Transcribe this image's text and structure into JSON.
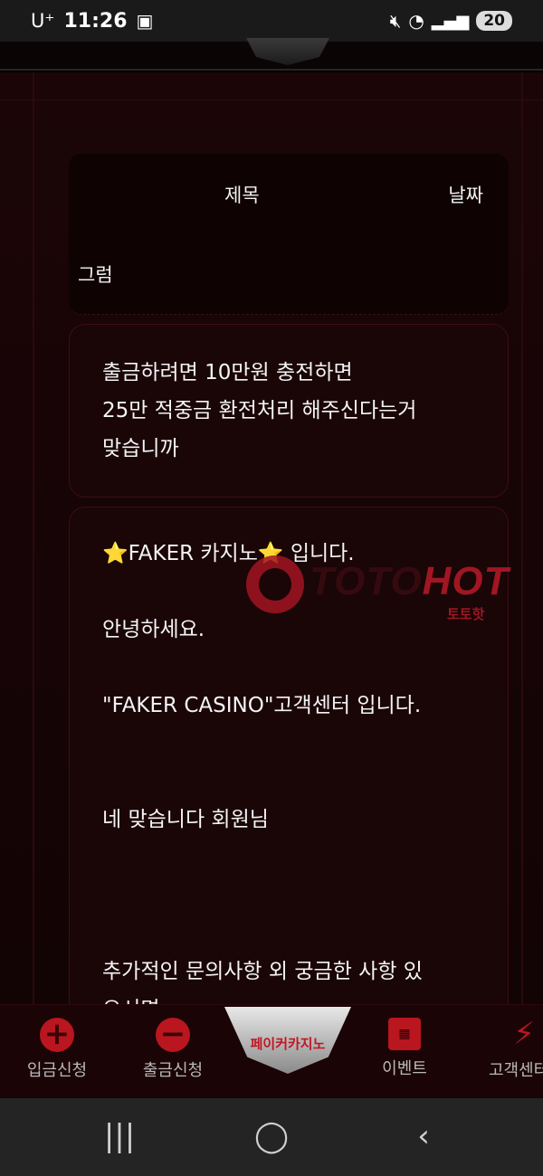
{
  "status_bar": {
    "carrier": "U⁺",
    "time": "11:26",
    "battery": "20"
  },
  "table": {
    "col_title": "제목",
    "col_date": "날짜",
    "row_title": "그럼"
  },
  "question": {
    "lines": [
      "출금하려면 10만원 충전하면",
      "25만 적중금 환전처리 해주신다는거",
      "맞습니까"
    ]
  },
  "answer": {
    "line1": "⭐FAKER 카지노⭐ 입니다.",
    "line2": "안녕하세요.",
    "line3": "\"FAKER CASINO\"고객센터 입니다.",
    "line4": "네 맞습니다 회원님",
    "line5": "추가적인 문의사항 외 궁금한 사항 있",
    "line6": "으시면"
  },
  "watermark": {
    "brand_a": "TOTO",
    "brand_b": "HOT",
    "sub": "토토핫"
  },
  "bottom_nav": {
    "deposit": "입금신청",
    "withdraw": "출금신청",
    "logo_text": "페이커카지노",
    "event": "이벤트",
    "support": "고객센터"
  },
  "colors": {
    "accent": "#b9161f",
    "background": "#160406"
  }
}
